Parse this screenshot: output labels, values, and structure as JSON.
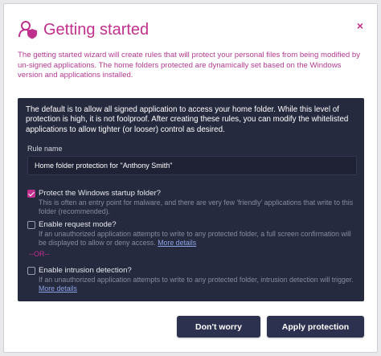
{
  "dialog": {
    "title": "Getting started",
    "close_icon": "×",
    "intro": "The getting started wizard will create rules that will protect your personal files from being modified by un-signed applications. The home folders protected are dynamically set based on the Windows version and applications installed."
  },
  "panel": {
    "description": "The default is to allow all signed application to access your home folder. While this level of protection is high, it is not foolproof. After creating these rules, you can modify the whitelisted applications to allow tighter (or looser) control as desired.",
    "rule_name_label": "Rule name",
    "rule_name_value": "Home folder protection for \"Anthony Smith\"",
    "options": [
      {
        "title": "Protect the Windows startup folder?",
        "description": "This is often an entry point for malware, and there are very few 'friendly' applications that write to this folder (recommended).",
        "checked": true
      },
      {
        "title": "Enable request mode?",
        "description": "If an unauthorized application attempts to write to any protected folder, a full screen confirmation will be displayed to allow or deny access.",
        "more": "More details",
        "checked": false
      },
      {
        "title": "Enable intrusion detection?",
        "description": "If an unauthorized application attempts to write to any protected folder, intrusion detection will trigger.",
        "more": "More details",
        "checked": false
      }
    ],
    "or_label": "--OR--"
  },
  "buttons": {
    "dont_worry": "Don't worry",
    "apply": "Apply protection"
  },
  "colors": {
    "accent": "#c0308d",
    "panel_bg": "#262a3f",
    "button_bg": "#2d3150"
  },
  "icons": {
    "title": "user-shield-icon",
    "close": "close-icon",
    "checkbox_checked": "checkmark-icon"
  }
}
